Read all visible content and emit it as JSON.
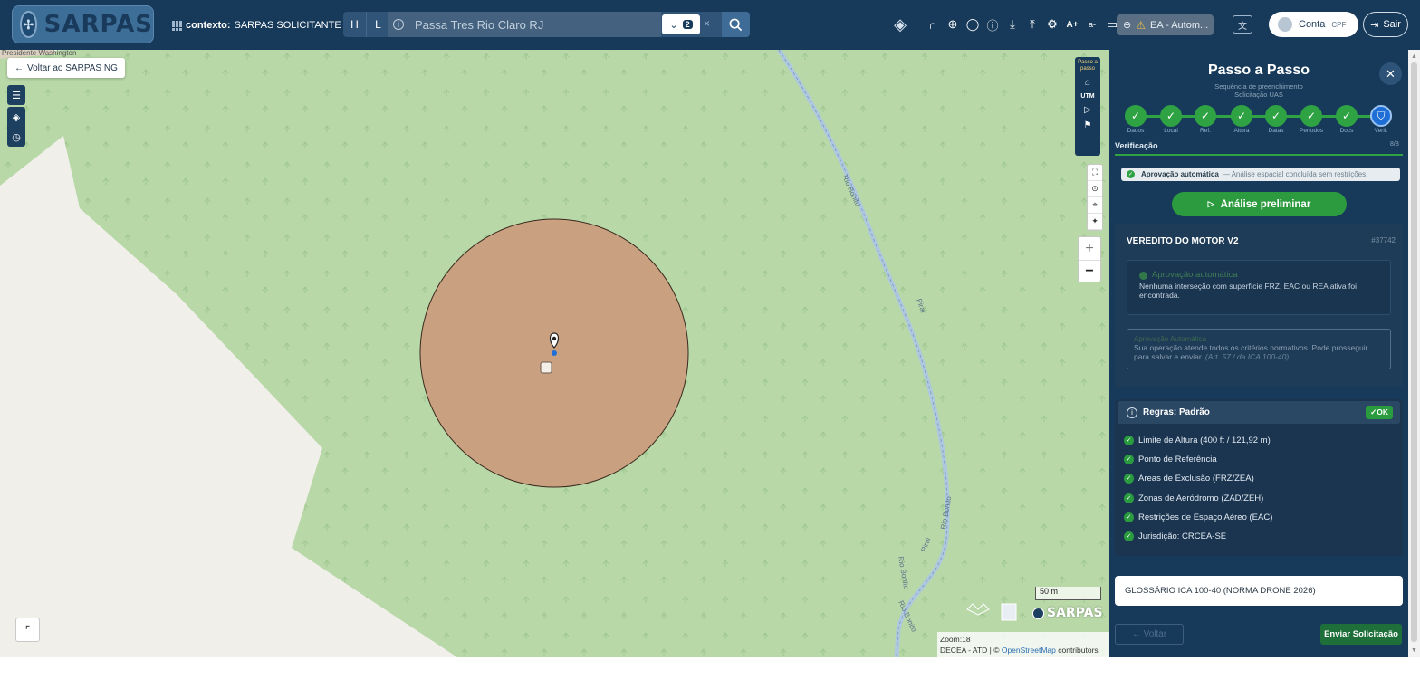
{
  "header": {
    "logo_text": "SARPAS",
    "context_label": "contexto:",
    "context_value": "SARPAS SOLICITANTE",
    "search": {
      "mode_h": "H",
      "mode_l": "L",
      "value": "Passa Tres Rio Claro RJ",
      "result_count": "2",
      "clear": "×"
    },
    "ea_label": "EA - Autom...",
    "account_label": "Conta",
    "account_sub": "CPF",
    "logout_label": "Sair",
    "font_plus": "A+",
    "font_minus": "a-"
  },
  "map": {
    "back_button": "Voltar ao SARPAS NG",
    "street_label": "Presidente Washington",
    "river_labels": [
      "Rio Bonito",
      "Rio Bonito",
      "Rio Bonito",
      "Pirai",
      "Pirai",
      "Rio Bonito"
    ],
    "utm_label": "UTM",
    "step_button": "Passo a passo",
    "scale": "50 m",
    "zoom": "Zoom:18",
    "attribution_prefix": "DECEA - ATD | ©",
    "attribution_link": "OpenStreetMap",
    "attribution_suffix": "contributors",
    "brand": "SARPAS",
    "zoom_in": "+",
    "zoom_out": "−",
    "circle_fill": "#c9a181"
  },
  "panel": {
    "title": "Passo a Passo",
    "subtitle_line1": "Sequência de preenchimento",
    "subtitle_line2": "Solicitação UAS",
    "steps": [
      {
        "label": "Dados"
      },
      {
        "label": "Local"
      },
      {
        "label": "Ref."
      },
      {
        "label": "Altura"
      },
      {
        "label": "Datas"
      },
      {
        "label": "Períodos"
      },
      {
        "label": "Docs"
      },
      {
        "label": "Verif."
      }
    ],
    "section": "Verificação",
    "section_count": "8/8",
    "auto_approval": "Aprovação automática",
    "auto_approval_detail": "— Análise espacial concluída sem restrições.",
    "preliminary_button": "Análise preliminar",
    "verdict": {
      "title": "VEREDITO DO MOTOR V2",
      "id": "#37742",
      "box1_heading": "Aprovação automática",
      "box1_text": "Nenhuma interseção com superfície FRZ, EAC ou REA ativa foi encontrada.",
      "box2_heading": "Aprovação Automática",
      "box2_text": "Sua operação atende todos os critérios normativos. Pode prosseguir para salvar e enviar.",
      "box2_ref": "(Art. 57 / da ICA 100-40)"
    },
    "rules": {
      "title": "Regras: Padrão",
      "status": "✓OK",
      "items": [
        "Limite de Altura (400 ft / 121,92 m)",
        "Ponto de Referência",
        "Áreas de Exclusão (FRZ/ZEA)",
        "Zonas de Aeródromo (ZAD/ZEH)",
        "Restrições de Espaço Aéreo (EAC)",
        "Jurisdição: CRCEA-SE"
      ]
    },
    "glossary": "GLOSSÁRIO ICA 100-40 (NORMA DRONE 2026)",
    "back": "← Voltar",
    "submit": "Enviar Solicitação",
    "colors": {
      "success": "#2fa344",
      "panel_bg": "#173a5a",
      "current_step": "#1e6ed6"
    }
  }
}
